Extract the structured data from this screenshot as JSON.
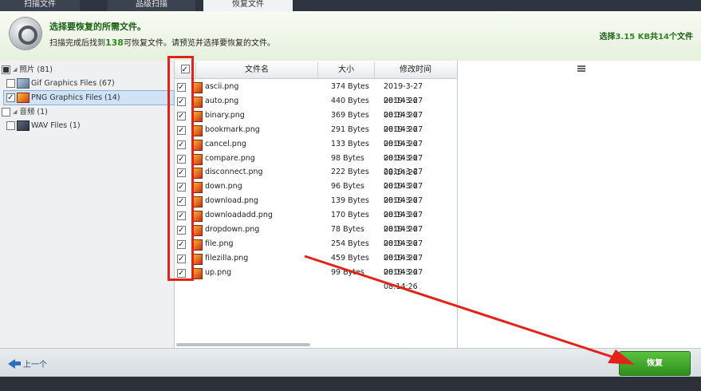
{
  "tabs": {
    "scan": "扫描文件",
    "deep": "品级扫描",
    "recover": "恢复文件"
  },
  "header": {
    "title": "选择要恢复的所需文件。",
    "sub_before": "扫描完成后找到",
    "found_count": "138",
    "sub_after": "可恢复文件。请预览并选择要恢复的文件。",
    "sel_prefix": "选择",
    "sel_size": "3.15 KB",
    "sel_mid": "共",
    "sel_count": "14",
    "sel_suffix": "个文件"
  },
  "tree": {
    "photos": "照片 (81)",
    "gif": "Gif Graphics Files (67)",
    "png": "PNG Graphics Files (14)",
    "audio": "音频 (1)",
    "wav": "WAV Files (1)"
  },
  "columns": {
    "name": "文件名",
    "size": "大小",
    "modified": "修改时间"
  },
  "files": [
    {
      "name": "ascii.png",
      "size": "374 Bytes",
      "time": "2019-3-27 08:14:26"
    },
    {
      "name": "auto.png",
      "size": "440 Bytes",
      "time": "2019-3-27 08:14:26"
    },
    {
      "name": "binary.png",
      "size": "369 Bytes",
      "time": "2019-3-27 08:14:26"
    },
    {
      "name": "bookmark.png",
      "size": "291 Bytes",
      "time": "2019-3-27 08:14:26"
    },
    {
      "name": "cancel.png",
      "size": "133 Bytes",
      "time": "2019-3-27 08:14:26"
    },
    {
      "name": "compare.png",
      "size": "98 Bytes",
      "time": "2019-3-27 08:14:26"
    },
    {
      "name": "disconnect.png",
      "size": "222 Bytes",
      "time": "2019-3-27 08:14:26"
    },
    {
      "name": "down.png",
      "size": "96 Bytes",
      "time": "2019-3-27 08:14:26"
    },
    {
      "name": "download.png",
      "size": "139 Bytes",
      "time": "2019-3-27 08:14:26"
    },
    {
      "name": "downloadadd.png",
      "size": "170 Bytes",
      "time": "2019-3-27 08:14:26"
    },
    {
      "name": "dropdown.png",
      "size": "78 Bytes",
      "time": "2019-3-27 08:14:26"
    },
    {
      "name": "file.png",
      "size": "254 Bytes",
      "time": "2019-3-27 08:14:26"
    },
    {
      "name": "filezilla.png",
      "size": "459 Bytes",
      "time": "2019-3-27 08:14:26"
    },
    {
      "name": "up.png",
      "size": "99 Bytes",
      "time": "2019-3-27 08:14:26"
    }
  ],
  "footer": {
    "back": "上一个",
    "recover": "恢复"
  },
  "colors": {
    "annotation": "#e2231a",
    "accent_green": "#2f8f1e",
    "header_text": "#1a5e12"
  }
}
